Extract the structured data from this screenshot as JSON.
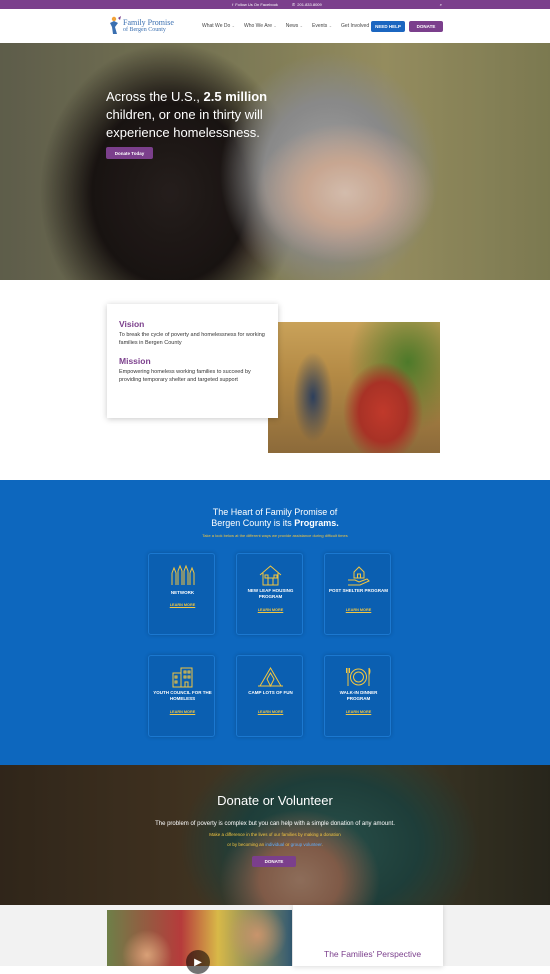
{
  "topbar": {
    "facebook": "Follow Us On Facebook",
    "phone": "201.833.8009"
  },
  "header": {
    "logo_line1": "Family Promise",
    "logo_line2": "of Bergen County",
    "nav": [
      {
        "label": "What We Do"
      },
      {
        "label": "Who We Are"
      },
      {
        "label": "News"
      },
      {
        "label": "Events"
      },
      {
        "label": "Get Involved"
      }
    ],
    "need_help": "NEED HELP",
    "donate": "DONATE"
  },
  "hero": {
    "line_pre": "Across the U.S., ",
    "line_bold": "2.5 million",
    "line_rest": " children, or one in thirty will experience homelessness.",
    "button": "Donate Today"
  },
  "about": {
    "vision_title": "Vision",
    "vision_body": "To break the cycle of poverty and homelessness for working families in Bergen County",
    "mission_title": "Mission",
    "mission_body": "Empowering homeless working families to succeed by providing temporary shelter and targeted support"
  },
  "programs": {
    "title_line1": "The Heart of Family Promise of",
    "title_line2_pre": "Bergen County is its ",
    "title_line2_bold": "Programs.",
    "subtitle": "Take a look below at the different ways we provide assistance during difficult times",
    "items": [
      {
        "label": "NETWORK",
        "link": "LEARN MORE",
        "icon": "hands-icon"
      },
      {
        "label": "NEW LEAF HOUSING PROGRAM",
        "link": "LEARN MORE",
        "icon": "house-icon"
      },
      {
        "label": "POST SHELTER PROGRAM",
        "link": "LEARN MORE",
        "icon": "hand-house-icon"
      },
      {
        "label": "YOUTH COUNCIL FOR THE HOMELESS",
        "link": "LEARN MORE",
        "icon": "buildings-icon"
      },
      {
        "label": "CAMP LOTS OF FUN",
        "link": "LEARN MORE",
        "icon": "tent-icon"
      },
      {
        "label": "WALK-IN DINNER PROGRAM",
        "link": "LEARN MORE",
        "icon": "plate-icon"
      }
    ]
  },
  "donate": {
    "title": "Donate or Volunteer",
    "line1": "The problem of poverty is complex but you can help with a simple donation of any amount.",
    "line2": "Make a difference in the lives of our families by making a donation",
    "line3_pre": "or by becoming an ",
    "line3_link1": "individual",
    "line3_mid": " or ",
    "line3_link2": "group volunteer",
    "line3_end": ".",
    "button": "DONATE"
  },
  "families": {
    "title": "The Families' Perspective"
  },
  "colors": {
    "purple": "#7b3f8c",
    "blue": "#0d67be",
    "gold": "#f3c640"
  }
}
